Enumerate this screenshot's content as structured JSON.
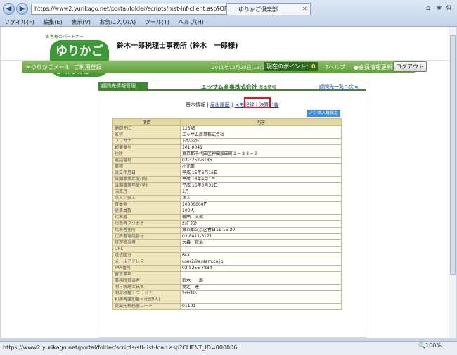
{
  "browser": {
    "url": "https://www2.yurikago.net/portal/folder/scripts/mst-inf-client.asp?OFFICE",
    "tab_title": "ゆりかご倶楽部",
    "menu": [
      "ファイル(F)",
      "編集(E)",
      "表示(V)",
      "お気に入り(A)",
      "ツール(T)",
      "ヘルプ(H)"
    ],
    "status_url": "https://www2.yurikago.net/portal/folder/scripts/stl-list-load.asp?CLIENT_ID=000006",
    "zoom": "100%"
  },
  "header": {
    "logo_text": "ゆりかご倶楽部",
    "logo_small": "お客様のパートナー",
    "office_name": "鈴木一郎税理士事務所 (鈴木　一郎様)"
  },
  "toolbar": {
    "mail": "ゆりかごメール",
    "register": "ご利用登録",
    "datetime": "2011年12月20日(19:03)",
    "points_label": "現在のポイント：",
    "points_value": "0",
    "help": "ヘルプ",
    "update": "会員情報更新",
    "logout": "ログアウト"
  },
  "content": {
    "section_label": "顧問先情報管理",
    "company_name": "エッサム商事株式会社",
    "company_suffix": "基本情報",
    "back_link": "顧問先一覧へ戻る",
    "subnav": {
      "basic": "基本情報",
      "history": "届出履歴",
      "memo": "メモ記録",
      "settlement": "決算公告"
    },
    "access_button": "アクセス権設定",
    "table_headers": [
      "項目",
      "内容"
    ],
    "rows": [
      {
        "k": "顧問先ID",
        "v": "12345"
      },
      {
        "k": "名称",
        "v": "エッサム商事株式会社"
      },
      {
        "k": "フリガナ",
        "v": "ｴｯｻﾑｼｮｳｼﾞ"
      },
      {
        "k": "郵便番号",
        "v": "101-0041"
      },
      {
        "k": "住所",
        "v": "東京都千代田区神田須田町１－２３－９"
      },
      {
        "k": "電話番号",
        "v": "03-3252-6186"
      },
      {
        "k": "業種",
        "v": "小売業"
      },
      {
        "k": "設立年月日",
        "v": "平成 15年6月15日"
      },
      {
        "k": "当期事業年度(自)",
        "v": "平成 15年4月1日"
      },
      {
        "k": "当期事業年度(至)",
        "v": "平成 16年3月31日"
      },
      {
        "k": "決算月",
        "v": "3月"
      },
      {
        "k": "法人／個人",
        "v": "法人"
      },
      {
        "k": "資本金",
        "v": "10000000円"
      },
      {
        "k": "従業員数",
        "v": "100人"
      },
      {
        "k": "代表者",
        "v": "神田　太郎"
      },
      {
        "k": "代表者フリガナ",
        "v": "ｶﾝﾀﾞﾀﾛｳ"
      },
      {
        "k": "代表者住所",
        "v": "東京都文京区春日11-15-20"
      },
      {
        "k": "代表者電話番号",
        "v": "03-8811-3171"
      },
      {
        "k": "経理担当者",
        "v": "大森　賢治"
      },
      {
        "k": "URL",
        "v": ""
      },
      {
        "k": "送信区分",
        "v": "FAX"
      },
      {
        "k": "メールアドレス",
        "v": "user2@essam.co.jp"
      },
      {
        "k": "FAX番号",
        "v": "03-5256-7884"
      },
      {
        "k": "留意事項",
        "v": ""
      },
      {
        "k": "事務所担当者",
        "v": "鈴木　一郎"
      },
      {
        "k": "関与税理士氏名",
        "v": "愛定　達"
      },
      {
        "k": "関与税理士フリガナ",
        "v": "ｱｲﾃｲﾀｽﾑ"
      },
      {
        "k": "利用者識別番号(代理人)",
        "v": ""
      },
      {
        "k": "提出先税務署コード",
        "v": "01101"
      }
    ]
  }
}
